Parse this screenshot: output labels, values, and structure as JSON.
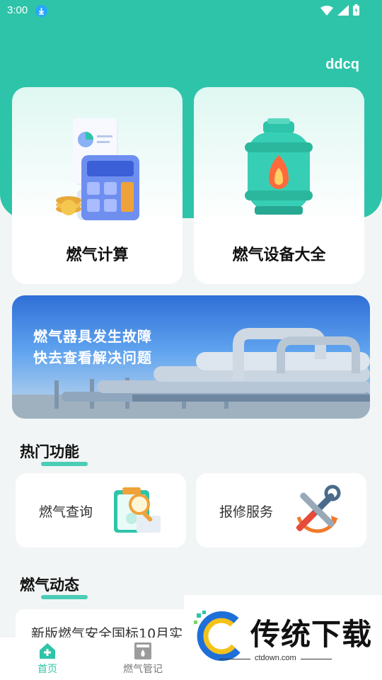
{
  "status_bar": {
    "time": "3:00"
  },
  "header": {
    "username": "ddcq"
  },
  "top_cards": [
    {
      "label": "燃气计算",
      "icon": "calculator-icon"
    },
    {
      "label": "燃气设备大全",
      "icon": "gas-cylinder-icon"
    }
  ],
  "banner": {
    "line1": "燃气器具发生故障",
    "line2": "快去查看解决问题"
  },
  "hot_section": {
    "title": "热门功能"
  },
  "features": [
    {
      "label": "燃气查询",
      "icon": "clipboard-search-icon"
    },
    {
      "label": "报修服务",
      "icon": "repair-tools-icon"
    }
  ],
  "news_section": {
    "title": "燃气动态"
  },
  "news": [
    {
      "title": "新版燃气安全国标10月实"
    }
  ],
  "tab_bar": [
    {
      "label": "首页",
      "icon": "home-icon",
      "active": true
    },
    {
      "label": "燃气管记",
      "icon": "stove-icon",
      "active": false
    }
  ],
  "watermark": {
    "brand": "传统下载",
    "domain": "ctdown.com"
  },
  "colors": {
    "accent": "#2ec4a9",
    "background": "#f2f5f5"
  }
}
